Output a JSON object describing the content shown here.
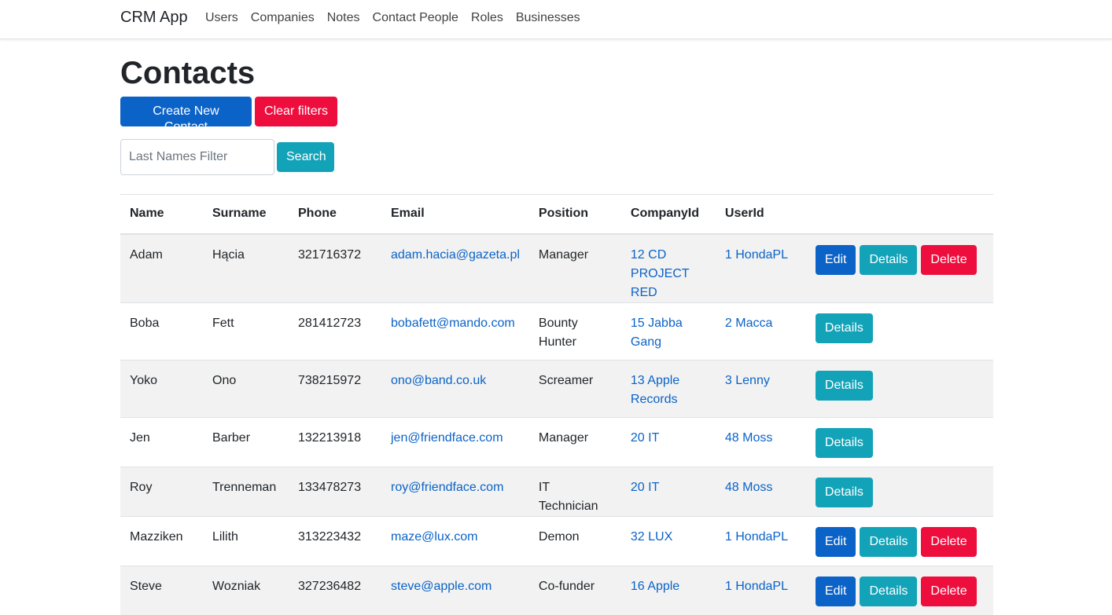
{
  "navbar": {
    "brand": "CRM App",
    "links": [
      "Users",
      "Companies",
      "Notes",
      "Contact People",
      "Roles",
      "Businesses"
    ]
  },
  "page": {
    "title": "Contacts",
    "create_label": "Create New Contact",
    "clear_label": "Clear filters",
    "filter_placeholder": "Last Names Filter",
    "filter_value": "",
    "search_label": "Search"
  },
  "table": {
    "headers": [
      "Name",
      "Surname",
      "Phone",
      "Email",
      "Position",
      "CompanyId",
      "UserId",
      ""
    ],
    "action_labels": {
      "edit": "Edit",
      "details": "Details",
      "delete": "Delete"
    },
    "rows": [
      {
        "name": "Adam",
        "surname": "Hącia",
        "phone": "321716372",
        "email": "adam.hacia@gazeta.pl",
        "position": "Manager",
        "company": "12 CD PROJECT RED",
        "user": "1 HondaPL",
        "can_edit": true
      },
      {
        "name": "Boba",
        "surname": "Fett",
        "phone": "281412723",
        "email": "bobafett@mando.com",
        "position": "Bounty Hunter",
        "company": "15 Jabba Gang",
        "user": "2 Macca",
        "can_edit": false
      },
      {
        "name": "Yoko",
        "surname": "Ono",
        "phone": "738215972",
        "email": "ono@band.co.uk",
        "position": "Screamer",
        "company": "13 Apple Records",
        "user": "3 Lenny",
        "can_edit": false
      },
      {
        "name": "Jen",
        "surname": "Barber",
        "phone": "132213918",
        "email": "jen@friendface.com",
        "position": "Manager",
        "company": "20 IT",
        "user": "48 Moss",
        "can_edit": false
      },
      {
        "name": "Roy",
        "surname": "Trenneman",
        "phone": "133478273",
        "email": "roy@friendface.com",
        "position": "IT Technician",
        "company": "20 IT",
        "user": "48 Moss",
        "can_edit": false
      },
      {
        "name": "Mazziken",
        "surname": "Lilith",
        "phone": "313223432",
        "email": "maze@lux.com",
        "position": "Demon",
        "company": "32 LUX",
        "user": "1 HondaPL",
        "can_edit": true
      },
      {
        "name": "Steve",
        "surname": "Wozniak",
        "phone": "327236482",
        "email": "steve@apple.com",
        "position": "Co-funder",
        "company": "16 Apple",
        "user": "1 HondaPL",
        "can_edit": true
      }
    ]
  },
  "colors": {
    "primary": "#0b63c8",
    "info": "#13a3b8",
    "danger": "#ee0e3e",
    "stripe": "#f2f2f2"
  }
}
